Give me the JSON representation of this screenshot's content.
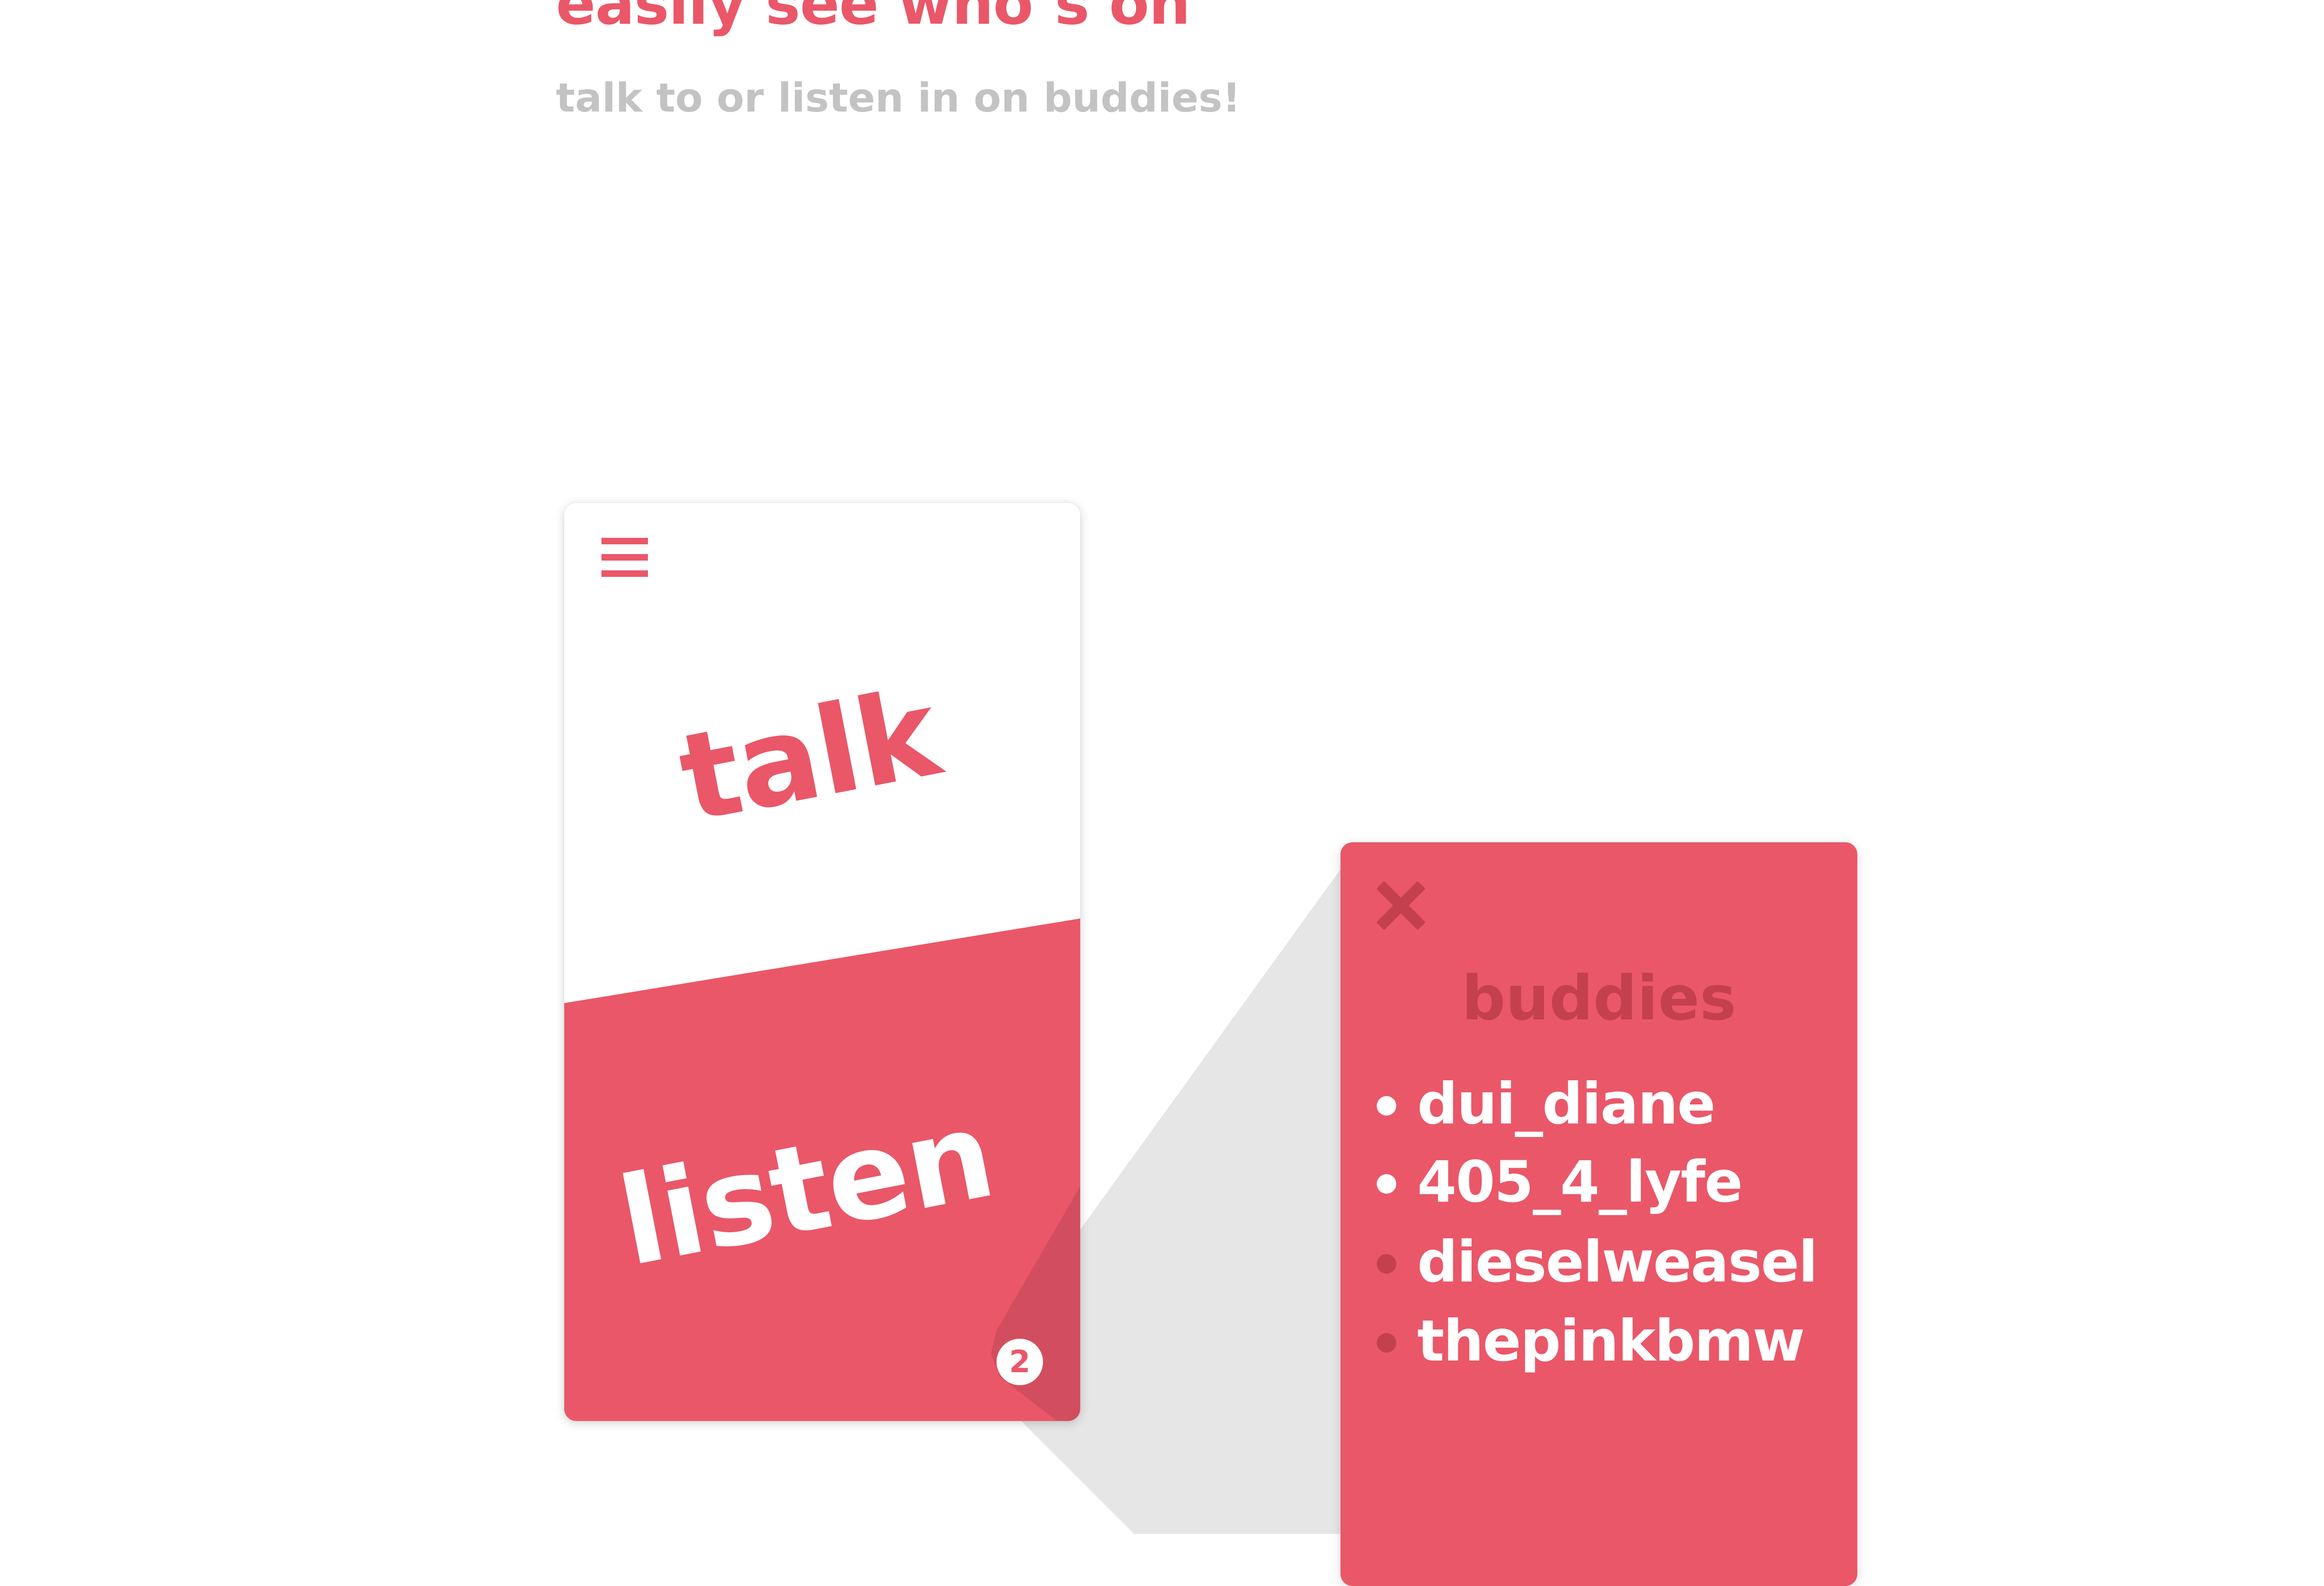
{
  "colors": {
    "accent": "#EA5769",
    "accent_dark": "#C5404F",
    "subtle_text": "#C3C3C3",
    "white": "#FFFFFF",
    "connector_grey": "#E6E6E6"
  },
  "header": {
    "title": "easily see who’s on",
    "subtitle": "talk to or listen in on buddies!"
  },
  "phone": {
    "menu_icon": "hamburger-menu-icon",
    "talk_label": "talk",
    "listen_label": "listen",
    "listen_count": "2"
  },
  "buddies_panel": {
    "close_icon": "close-x-icon",
    "title": "buddies",
    "items": [
      {
        "name": "dui_diane",
        "online": true
      },
      {
        "name": "405_4_lyfe",
        "online": true
      },
      {
        "name": "dieselweasel",
        "online": false
      },
      {
        "name": "thepinkbmw",
        "online": false
      }
    ]
  }
}
